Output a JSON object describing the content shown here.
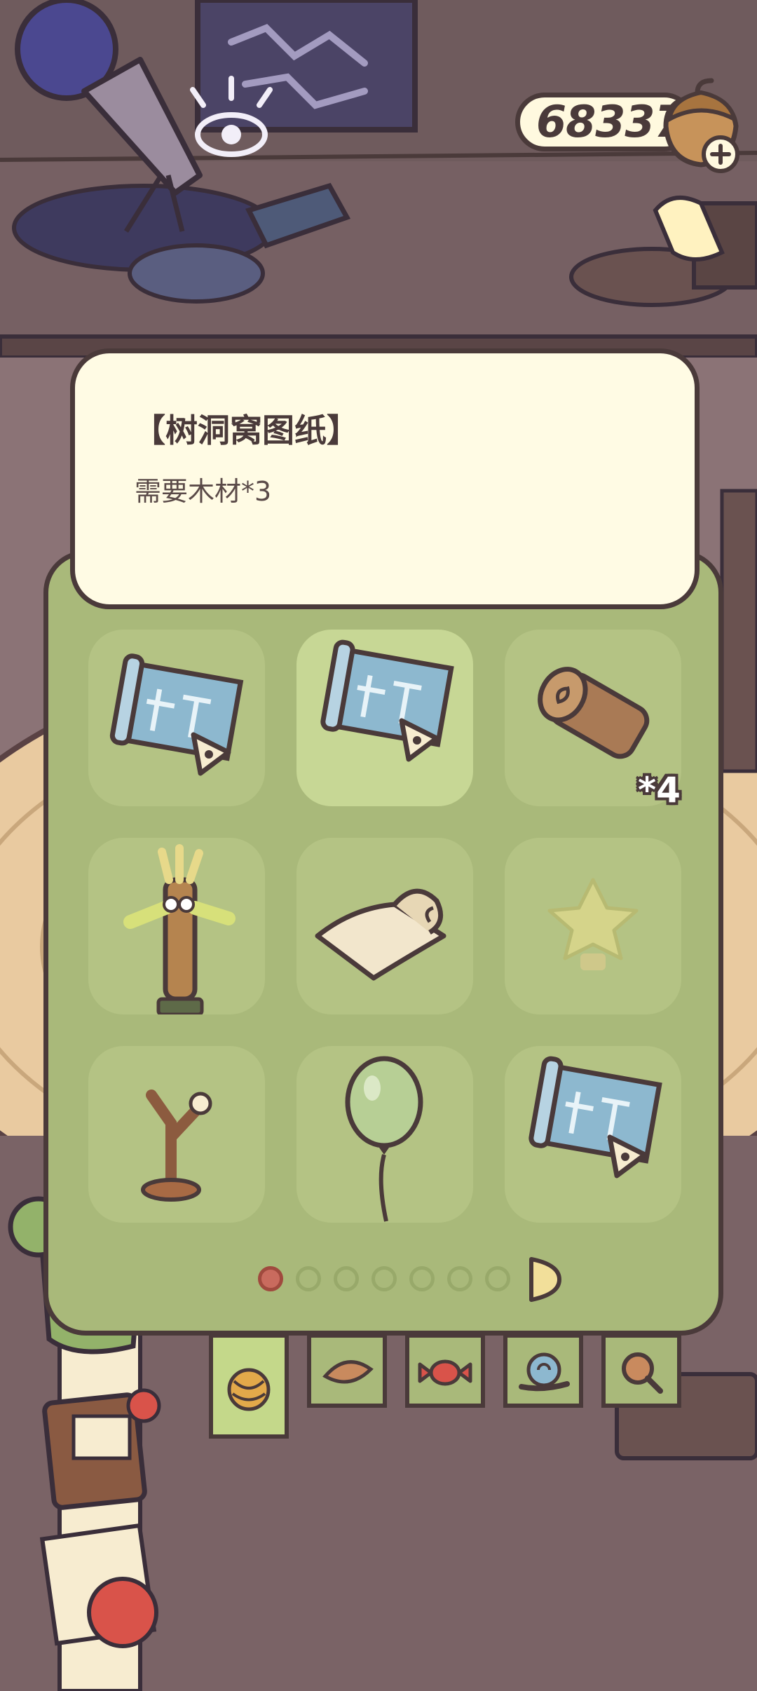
{
  "currency": {
    "amount": "68337",
    "icon": "acorn-icon",
    "add_icon": "plus-icon"
  },
  "tooltip": {
    "title": "【树洞窝图纸】",
    "description": "需要木材*3"
  },
  "inventory": {
    "items": [
      {
        "name": "blueprint",
        "icon": "blueprint-icon",
        "selected": false,
        "quantity": ""
      },
      {
        "name": "blueprint",
        "icon": "blueprint-icon",
        "selected": true,
        "quantity": ""
      },
      {
        "name": "wood-log",
        "icon": "wood-log-icon",
        "selected": false,
        "quantity": "*4"
      },
      {
        "name": "tube-dancer",
        "icon": "tube-dancer-icon",
        "selected": false,
        "quantity": ""
      },
      {
        "name": "paper-scroll",
        "icon": "paper-scroll-icon",
        "selected": false,
        "quantity": ""
      },
      {
        "name": "star-lamp",
        "icon": "star-lamp-icon",
        "selected": false,
        "quantity": ""
      },
      {
        "name": "branch-lamp",
        "icon": "branch-lamp-icon",
        "selected": false,
        "quantity": ""
      },
      {
        "name": "green-balloon",
        "icon": "balloon-icon",
        "selected": false,
        "quantity": ""
      },
      {
        "name": "blueprint",
        "icon": "blueprint-icon",
        "selected": false,
        "quantity": ""
      }
    ],
    "pagination": {
      "current_page": 1,
      "total_pages": 7
    }
  },
  "category_tabs": [
    {
      "icon": "yarn-ball-icon",
      "active": true
    },
    {
      "icon": "leaf-icon",
      "active": false
    },
    {
      "icon": "candy-icon",
      "active": false
    },
    {
      "icon": "snail-icon",
      "active": false
    },
    {
      "icon": "magnifier-icon",
      "active": false
    }
  ],
  "colors": {
    "panel": "#a9b97a",
    "outline": "#4a3a3a",
    "tooltip_bg": "#fffbe4",
    "active_dot": "#c96b5e"
  }
}
